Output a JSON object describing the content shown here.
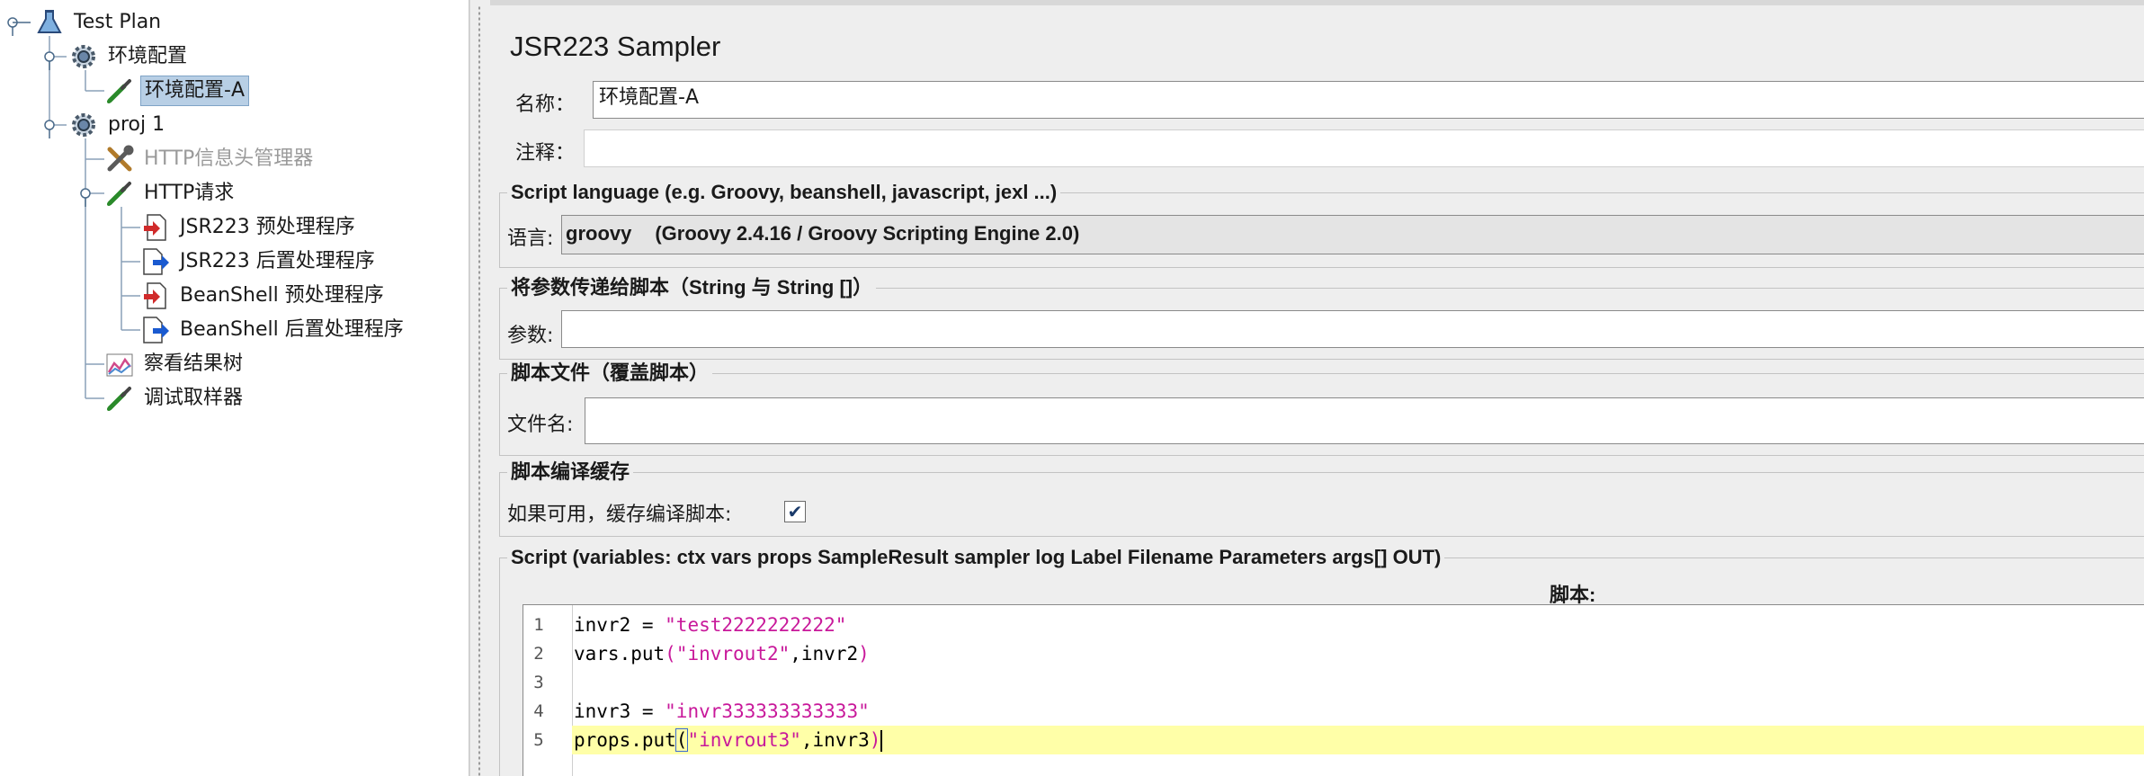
{
  "tree": {
    "items": [
      {
        "id": "test-plan",
        "label": "Test Plan",
        "icon": "flask-icon",
        "disabled": false,
        "selected": false
      },
      {
        "id": "env-config",
        "label": "环境配置",
        "icon": "gear-icon",
        "disabled": false,
        "selected": false
      },
      {
        "id": "env-config-a",
        "label": "环境配置-A",
        "icon": "pipette-icon",
        "disabled": false,
        "selected": true
      },
      {
        "id": "proj1",
        "label": "proj 1",
        "icon": "gear-icon",
        "disabled": false,
        "selected": false
      },
      {
        "id": "http-header-manager",
        "label": "HTTP信息头管理器",
        "icon": "tools-icon",
        "disabled": true,
        "selected": false
      },
      {
        "id": "http-request",
        "label": "HTTP请求",
        "icon": "pipette-icon",
        "disabled": false,
        "selected": false
      },
      {
        "id": "jsr223-pre",
        "label": "JSR223 预处理程序",
        "icon": "pre-processor-icon",
        "disabled": false,
        "selected": false
      },
      {
        "id": "jsr223-post",
        "label": "JSR223 后置处理程序",
        "icon": "post-processor-icon",
        "disabled": false,
        "selected": false
      },
      {
        "id": "beanshell-pre",
        "label": "BeanShell 预处理程序",
        "icon": "pre-processor-icon",
        "disabled": false,
        "selected": false
      },
      {
        "id": "beanshell-post",
        "label": "BeanShell 后置处理程序",
        "icon": "post-processor-icon",
        "disabled": false,
        "selected": false
      },
      {
        "id": "view-results-tree",
        "label": "察看结果树",
        "icon": "graph-icon",
        "disabled": false,
        "selected": false
      },
      {
        "id": "debug-sampler",
        "label": "调试取样器",
        "icon": "pipette-icon",
        "disabled": false,
        "selected": false
      }
    ]
  },
  "panel": {
    "title": "JSR223 Sampler",
    "name_label": "名称：",
    "name_value": "环境配置-A",
    "comment_label": "注释：",
    "comment_value": "",
    "language_group": {
      "title": "Script language (e.g. Groovy, beanshell, javascript, jexl ...)",
      "label": "语言:",
      "selected": "groovy",
      "description": "(Groovy 2.4.16 / Groovy Scripting Engine 2.0)"
    },
    "params_group": {
      "title": "将参数传递给脚本（String 与 String []）",
      "label": "参数:",
      "value": ""
    },
    "file_group": {
      "title": "脚本文件（覆盖脚本）",
      "label": "文件名:",
      "value": ""
    },
    "cache_group": {
      "title": "脚本编译缓存",
      "label": "如果可用，缓存编译脚本:",
      "checked_mark": "✔",
      "checked": true
    },
    "script_group": {
      "title": "Script (variables: ctx vars props SampleResult sampler log Label Filename Parameters args[] OUT)",
      "label": "脚本:",
      "line_numbers": [
        "1",
        "2",
        "3",
        "4",
        "5"
      ],
      "lines": [
        {
          "pre": "invr2 = ",
          "str": "\"test2222222222\"",
          "post": "",
          "tail": ""
        },
        {
          "pre": "vars.put",
          "paren_open": "(",
          "str": "\"invrout2\"",
          "post": ",invr2",
          "paren_close": ")"
        },
        {
          "pre": "",
          "str": "",
          "post": "",
          "tail": ""
        },
        {
          "pre": "invr3 = ",
          "str": "\"invr333333333333\"",
          "post": "",
          "tail": ""
        },
        {
          "pre": "props.put",
          "paren_open": "(",
          "str": "\"invrout3\"",
          "post": ",invr3",
          "paren_close": ")"
        }
      ]
    }
  },
  "colors": {
    "selection": "#b8cfe5",
    "string": "#c8189a",
    "current_line": "#ffffa8"
  }
}
